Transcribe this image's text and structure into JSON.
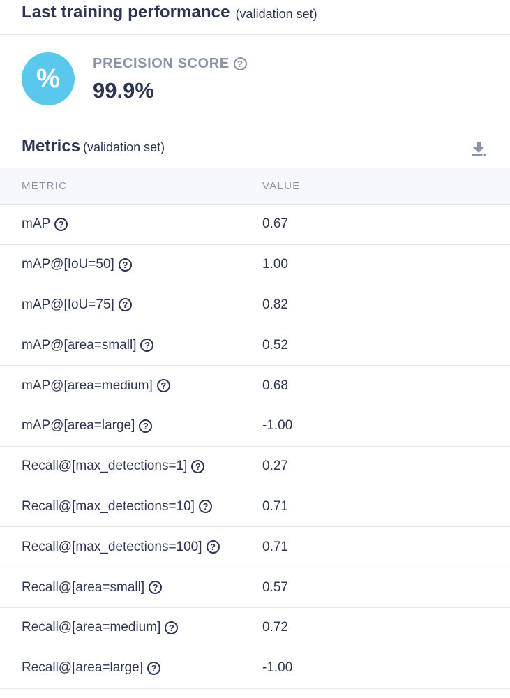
{
  "header": {
    "title": "Last training performance",
    "subtitle": "(validation set)"
  },
  "precision": {
    "icon_symbol": "%",
    "label": "PRECISION SCORE",
    "value": "99.9%"
  },
  "metrics": {
    "title": "Metrics",
    "subtitle": "(validation set)",
    "download_icon": "download-icon",
    "columns": {
      "metric": "METRIC",
      "value": "VALUE"
    },
    "rows": [
      {
        "metric": "mAP",
        "value": "0.67"
      },
      {
        "metric": "mAP@[IoU=50]",
        "value": "1.00"
      },
      {
        "metric": "mAP@[IoU=75]",
        "value": "0.82"
      },
      {
        "metric": "mAP@[area=small]",
        "value": "0.52"
      },
      {
        "metric": "mAP@[area=medium]",
        "value": "0.68"
      },
      {
        "metric": "mAP@[area=large]",
        "value": "-1.00"
      },
      {
        "metric": "Recall@[max_detections=1]",
        "value": "0.27"
      },
      {
        "metric": "Recall@[max_detections=10]",
        "value": "0.71"
      },
      {
        "metric": "Recall@[max_detections=100]",
        "value": "0.71"
      },
      {
        "metric": "Recall@[area=small]",
        "value": "0.57"
      },
      {
        "metric": "Recall@[area=medium]",
        "value": "0.72"
      },
      {
        "metric": "Recall@[area=large]",
        "value": "-1.00"
      }
    ]
  },
  "colors": {
    "accent": "#5ac8ec",
    "text": "#2d3552",
    "muted": "#8a93a8"
  }
}
